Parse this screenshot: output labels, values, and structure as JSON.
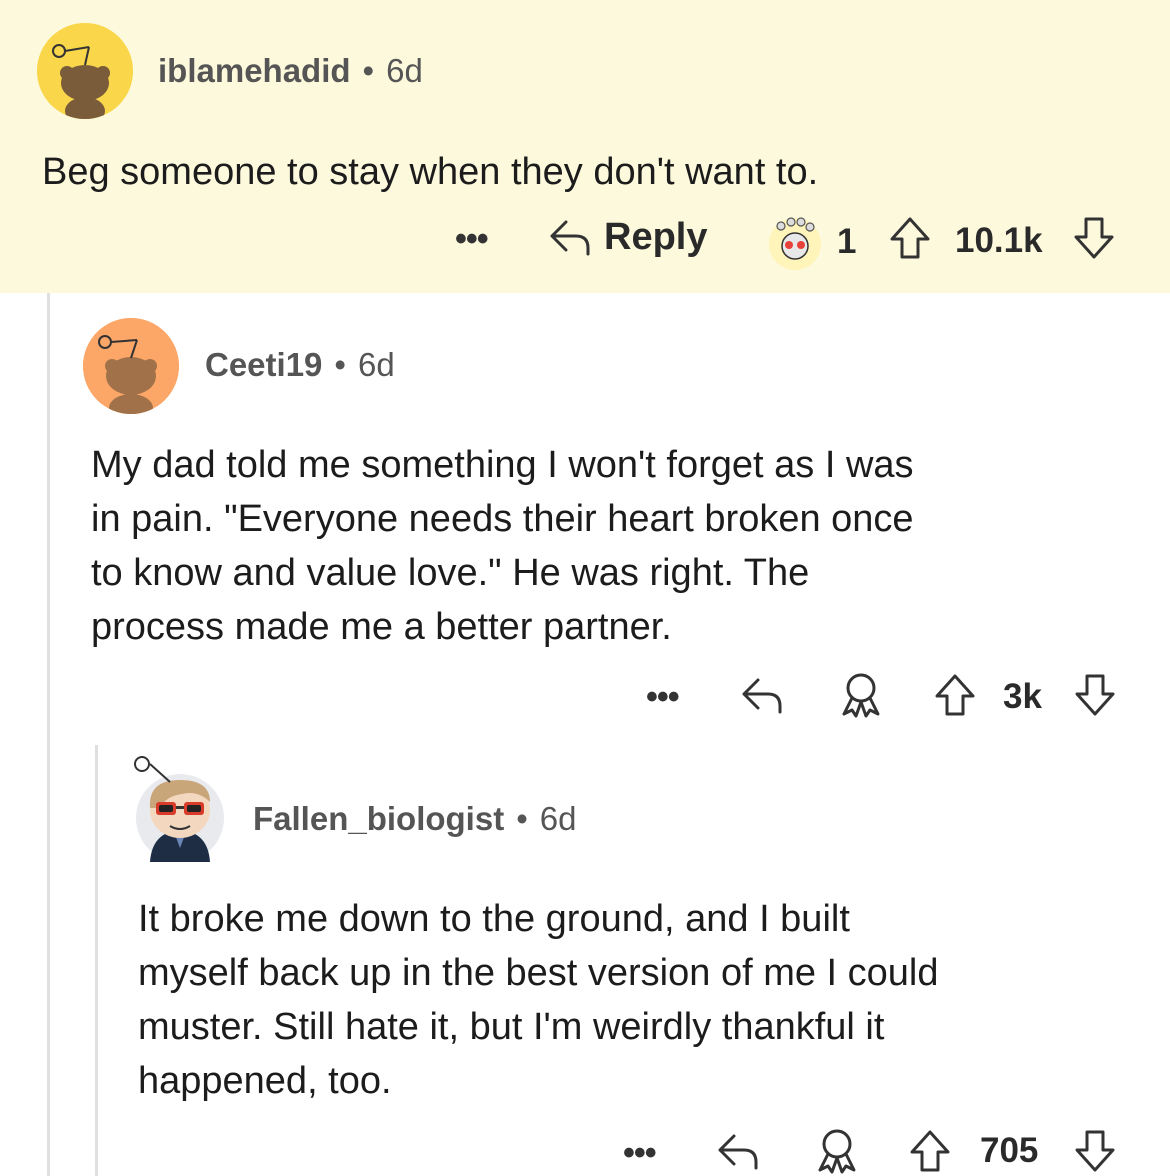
{
  "comments": [
    {
      "username": "iblamehadid",
      "separator": "•",
      "age": "6d",
      "text": "Beg someone to stay when they don't want to.",
      "more": "•••",
      "reply_label": "Reply",
      "award_count": "1",
      "votes": "10.1k",
      "avatar_color": "#fad74a",
      "highlight_color": "#fdf9dc"
    },
    {
      "username": "Ceeti19",
      "separator": "•",
      "age": "6d",
      "text_lines": [
        "My dad told me something I won't forget as I was",
        "in pain.  \"Everyone needs their heart broken once",
        "to know and value love.\" He was right. The",
        "process made me a better partner."
      ],
      "more": "•••",
      "votes": "3k",
      "avatar_color": "#fca667"
    },
    {
      "username": "Fallen_biologist",
      "separator": "•",
      "age": "6d",
      "text_lines": [
        "It broke me down to the ground, and I built",
        "myself back up in the best version of me I could",
        "muster. Still hate it, but I'm weirdly thankful it",
        "happened, too."
      ],
      "more": "•••",
      "votes": "705",
      "avatar_color": "#e8eaed"
    }
  ],
  "icons": {
    "reply": "reply-arrow-icon",
    "award": "award-icon",
    "upvote": "upvote-arrow-icon",
    "downvote": "downvote-arrow-icon",
    "gold_award": "gold-award-icon"
  }
}
